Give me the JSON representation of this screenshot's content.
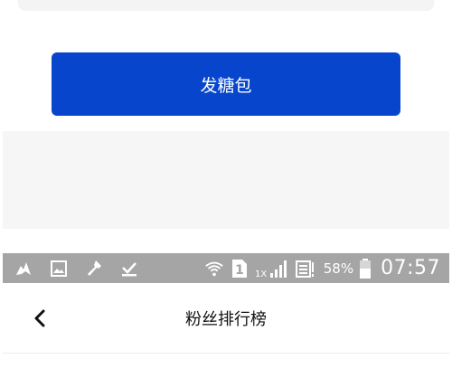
{
  "form": {
    "send_button_label": "发糖包"
  },
  "status_bar": {
    "left_icons": [
      "bird-notification-icon",
      "image-notification-icon",
      "flashlight-icon",
      "download-done-icon"
    ],
    "sim_slot": "1",
    "network_type": "1X",
    "battery_percent": "58%",
    "time": "07:57"
  },
  "nav": {
    "title": "粉丝排行榜",
    "back_icon": "chevron-left-icon"
  },
  "colors": {
    "primary": "#0746cc",
    "status_bar_bg": "#a5a5a5",
    "panel_bg": "#f6f6f6"
  }
}
